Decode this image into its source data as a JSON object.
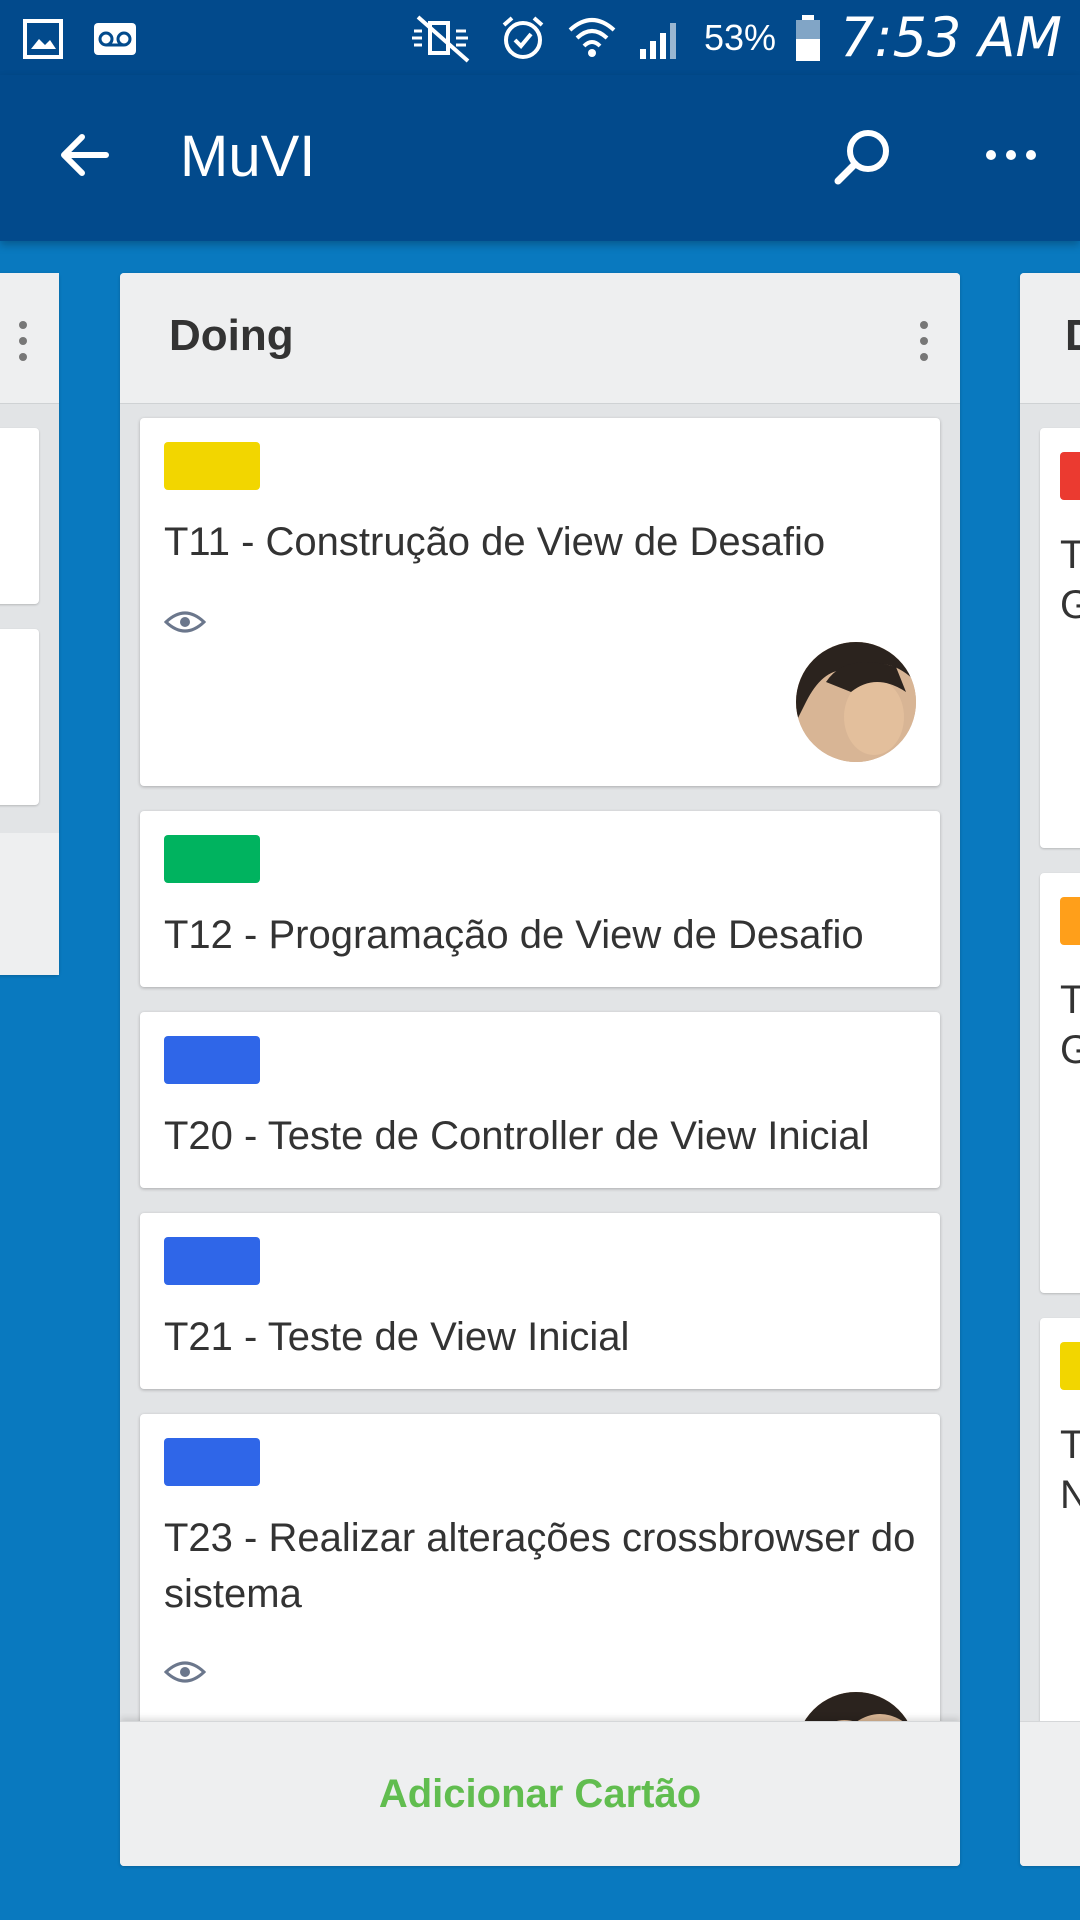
{
  "status_bar": {
    "battery": "53%",
    "time": "7:53 AM"
  },
  "app_bar": {
    "title": "MuVI"
  },
  "list": {
    "title": "Doing",
    "add_card_label": "Adicionar Cartão",
    "cards": [
      {
        "label_color": "#f2d600",
        "title": "T11 - Construção de View de Desafio",
        "watching": true,
        "has_member": true
      },
      {
        "label_color": "#00b35f",
        "title": "T12 - Programação de View de Desafio",
        "watching": false,
        "has_member": false
      },
      {
        "label_color": "#2f66e8",
        "title": "T20 - Teste de Controller de View Inicial",
        "watching": false,
        "has_member": false
      },
      {
        "label_color": "#2f66e8",
        "title": "T21 - Teste de View Inicial",
        "watching": false,
        "has_member": false
      },
      {
        "label_color": "#2f66e8",
        "title": "T23 - Realizar alterações crossbrowser do sistema",
        "watching": true,
        "has_member": true
      }
    ]
  },
  "right_list": {
    "title_peek": "D",
    "cards": [
      {
        "label_color": "#eb3a30",
        "lines": [
          "T",
          "G"
        ]
      },
      {
        "label_color": "#ff9f1a",
        "lines": [
          "T",
          "G"
        ]
      },
      {
        "label_color": "#f2d600",
        "lines": [
          "T",
          "N"
        ]
      }
    ]
  },
  "icons": {
    "status_left": [
      "gallery-icon",
      "voicemail-icon"
    ],
    "status_right": [
      "mute-icon",
      "alarm-icon",
      "wifi-icon",
      "signal-icon",
      "battery-icon"
    ],
    "app_bar": [
      "back-arrow-icon",
      "search-icon",
      "more-icon"
    ]
  }
}
